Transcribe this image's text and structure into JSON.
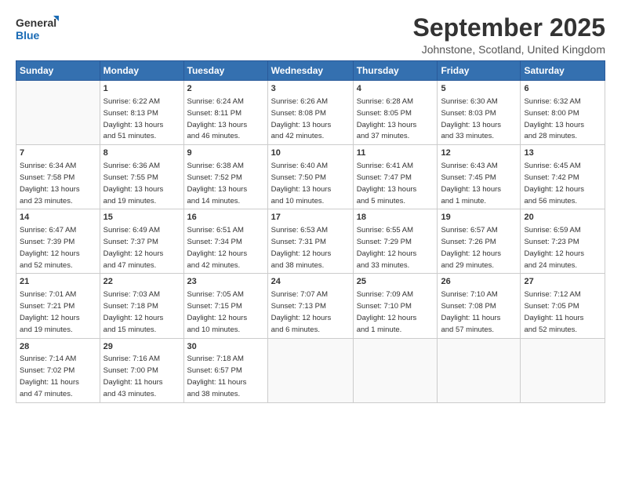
{
  "logo": {
    "general": "General",
    "blue": "Blue"
  },
  "title": {
    "month": "September 2025",
    "location": "Johnstone, Scotland, United Kingdom"
  },
  "weekdays": [
    "Sunday",
    "Monday",
    "Tuesday",
    "Wednesday",
    "Thursday",
    "Friday",
    "Saturday"
  ],
  "weeks": [
    [
      {
        "day": "",
        "detail": ""
      },
      {
        "day": "1",
        "detail": "Sunrise: 6:22 AM\nSunset: 8:13 PM\nDaylight: 13 hours\nand 51 minutes."
      },
      {
        "day": "2",
        "detail": "Sunrise: 6:24 AM\nSunset: 8:11 PM\nDaylight: 13 hours\nand 46 minutes."
      },
      {
        "day": "3",
        "detail": "Sunrise: 6:26 AM\nSunset: 8:08 PM\nDaylight: 13 hours\nand 42 minutes."
      },
      {
        "day": "4",
        "detail": "Sunrise: 6:28 AM\nSunset: 8:05 PM\nDaylight: 13 hours\nand 37 minutes."
      },
      {
        "day": "5",
        "detail": "Sunrise: 6:30 AM\nSunset: 8:03 PM\nDaylight: 13 hours\nand 33 minutes."
      },
      {
        "day": "6",
        "detail": "Sunrise: 6:32 AM\nSunset: 8:00 PM\nDaylight: 13 hours\nand 28 minutes."
      }
    ],
    [
      {
        "day": "7",
        "detail": "Sunrise: 6:34 AM\nSunset: 7:58 PM\nDaylight: 13 hours\nand 23 minutes."
      },
      {
        "day": "8",
        "detail": "Sunrise: 6:36 AM\nSunset: 7:55 PM\nDaylight: 13 hours\nand 19 minutes."
      },
      {
        "day": "9",
        "detail": "Sunrise: 6:38 AM\nSunset: 7:52 PM\nDaylight: 13 hours\nand 14 minutes."
      },
      {
        "day": "10",
        "detail": "Sunrise: 6:40 AM\nSunset: 7:50 PM\nDaylight: 13 hours\nand 10 minutes."
      },
      {
        "day": "11",
        "detail": "Sunrise: 6:41 AM\nSunset: 7:47 PM\nDaylight: 13 hours\nand 5 minutes."
      },
      {
        "day": "12",
        "detail": "Sunrise: 6:43 AM\nSunset: 7:45 PM\nDaylight: 13 hours\nand 1 minute."
      },
      {
        "day": "13",
        "detail": "Sunrise: 6:45 AM\nSunset: 7:42 PM\nDaylight: 12 hours\nand 56 minutes."
      }
    ],
    [
      {
        "day": "14",
        "detail": "Sunrise: 6:47 AM\nSunset: 7:39 PM\nDaylight: 12 hours\nand 52 minutes."
      },
      {
        "day": "15",
        "detail": "Sunrise: 6:49 AM\nSunset: 7:37 PM\nDaylight: 12 hours\nand 47 minutes."
      },
      {
        "day": "16",
        "detail": "Sunrise: 6:51 AM\nSunset: 7:34 PM\nDaylight: 12 hours\nand 42 minutes."
      },
      {
        "day": "17",
        "detail": "Sunrise: 6:53 AM\nSunset: 7:31 PM\nDaylight: 12 hours\nand 38 minutes."
      },
      {
        "day": "18",
        "detail": "Sunrise: 6:55 AM\nSunset: 7:29 PM\nDaylight: 12 hours\nand 33 minutes."
      },
      {
        "day": "19",
        "detail": "Sunrise: 6:57 AM\nSunset: 7:26 PM\nDaylight: 12 hours\nand 29 minutes."
      },
      {
        "day": "20",
        "detail": "Sunrise: 6:59 AM\nSunset: 7:23 PM\nDaylight: 12 hours\nand 24 minutes."
      }
    ],
    [
      {
        "day": "21",
        "detail": "Sunrise: 7:01 AM\nSunset: 7:21 PM\nDaylight: 12 hours\nand 19 minutes."
      },
      {
        "day": "22",
        "detail": "Sunrise: 7:03 AM\nSunset: 7:18 PM\nDaylight: 12 hours\nand 15 minutes."
      },
      {
        "day": "23",
        "detail": "Sunrise: 7:05 AM\nSunset: 7:15 PM\nDaylight: 12 hours\nand 10 minutes."
      },
      {
        "day": "24",
        "detail": "Sunrise: 7:07 AM\nSunset: 7:13 PM\nDaylight: 12 hours\nand 6 minutes."
      },
      {
        "day": "25",
        "detail": "Sunrise: 7:09 AM\nSunset: 7:10 PM\nDaylight: 12 hours\nand 1 minute."
      },
      {
        "day": "26",
        "detail": "Sunrise: 7:10 AM\nSunset: 7:08 PM\nDaylight: 11 hours\nand 57 minutes."
      },
      {
        "day": "27",
        "detail": "Sunrise: 7:12 AM\nSunset: 7:05 PM\nDaylight: 11 hours\nand 52 minutes."
      }
    ],
    [
      {
        "day": "28",
        "detail": "Sunrise: 7:14 AM\nSunset: 7:02 PM\nDaylight: 11 hours\nand 47 minutes."
      },
      {
        "day": "29",
        "detail": "Sunrise: 7:16 AM\nSunset: 7:00 PM\nDaylight: 11 hours\nand 43 minutes."
      },
      {
        "day": "30",
        "detail": "Sunrise: 7:18 AM\nSunset: 6:57 PM\nDaylight: 11 hours\nand 38 minutes."
      },
      {
        "day": "",
        "detail": ""
      },
      {
        "day": "",
        "detail": ""
      },
      {
        "day": "",
        "detail": ""
      },
      {
        "day": "",
        "detail": ""
      }
    ]
  ]
}
